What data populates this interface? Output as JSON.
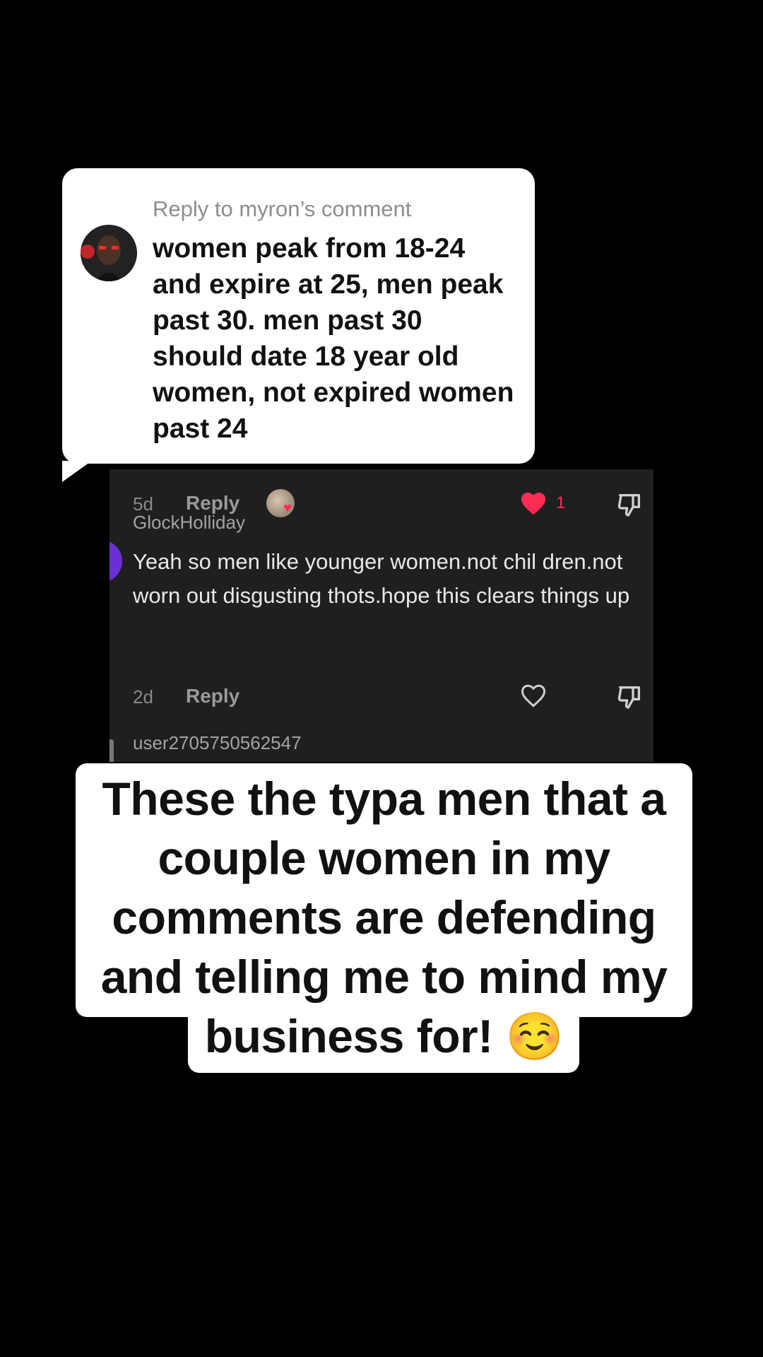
{
  "reply_bubble": {
    "header": "Reply to myron’s comment",
    "text": "women peak from 18-24 and expire at 25, men peak past 30. men past 30 should date 18 year old women, not expired women past 24"
  },
  "comments": [
    {
      "time": "5d",
      "reply_label": "Reply",
      "like_count": "1",
      "liked": true
    },
    {
      "username": "GlockHolliday",
      "text": "Yeah so men like younger women.not chil dren.not worn out disgusting thots.hope this clears things up",
      "time": "2d",
      "reply_label": "Reply",
      "liked": false
    },
    {
      "username": "user2705750562547"
    }
  ],
  "caption": {
    "text": "These the typa men that a couple women in my comments are defending and telling me to mind my business for! ☺️"
  },
  "colors": {
    "like_red": "#fe2c55",
    "panel_bg": "#1f1f1f",
    "avatar_purple": "#6a2fd6"
  },
  "icons": {
    "like": "heart-icon",
    "dislike": "thumbs-down-icon"
  }
}
